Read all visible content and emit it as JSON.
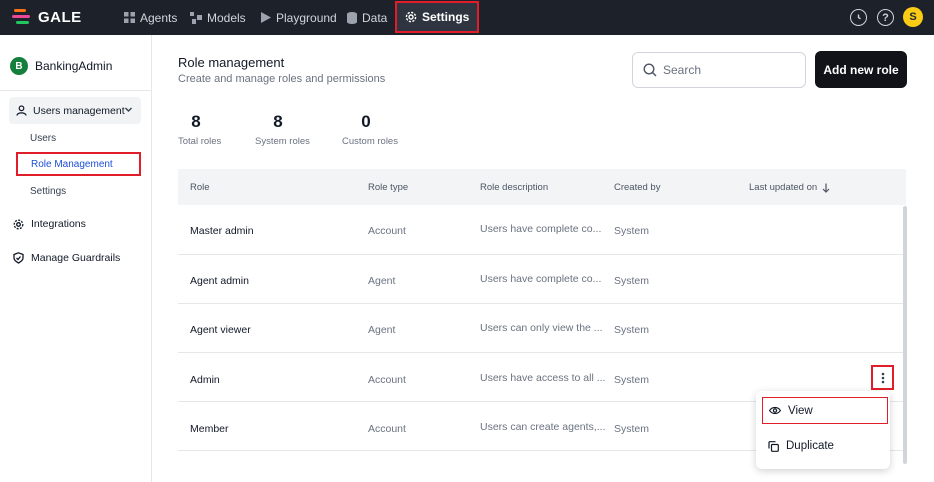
{
  "topbar": {
    "logo_text": "GALE",
    "nav": [
      {
        "label": "Agents",
        "icon": "grid-icon"
      },
      {
        "label": "Models",
        "icon": "models-icon"
      },
      {
        "label": "Playground",
        "icon": "play-icon"
      },
      {
        "label": "Data",
        "icon": "database-icon"
      },
      {
        "label": "Settings",
        "icon": "gear-icon",
        "active": true
      }
    ],
    "user_initial": "S"
  },
  "sidebar": {
    "org_initial": "B",
    "org_name": "BankingAdmin",
    "group_label": "Users management",
    "sub_items": [
      "Users",
      "Role Management",
      "Settings"
    ],
    "items": [
      "Integrations",
      "Manage Guardrails"
    ]
  },
  "main": {
    "title": "Role management",
    "subtitle": "Create and manage roles and permissions",
    "search_placeholder": "Search",
    "add_button": "Add new role",
    "stats": [
      {
        "value": "8",
        "label": "Total roles"
      },
      {
        "value": "8",
        "label": "System roles"
      },
      {
        "value": "0",
        "label": "Custom roles"
      }
    ],
    "columns": [
      "Role",
      "Role type",
      "Role description",
      "Created by",
      "Last updated on"
    ],
    "rows": [
      {
        "role": "Master admin",
        "type": "Account",
        "desc": "Users have complete co...",
        "by": "System"
      },
      {
        "role": "Agent admin",
        "type": "Agent",
        "desc": "Users have complete co...",
        "by": "System"
      },
      {
        "role": "Agent viewer",
        "type": "Agent",
        "desc": "Users can only view the ...",
        "by": "System"
      },
      {
        "role": "Admin",
        "type": "Account",
        "desc": "Users have access to all ...",
        "by": "System"
      },
      {
        "role": "Member",
        "type": "Account",
        "desc": "Users can create agents,...",
        "by": "System"
      }
    ],
    "context_menu": [
      "View",
      "Duplicate"
    ]
  },
  "colors": {
    "topbar_bg": "#1d2129",
    "highlight": "#e11d2a",
    "active_link": "#1d4ed8",
    "org_badge": "#15803d",
    "user_avatar": "#facc15"
  }
}
